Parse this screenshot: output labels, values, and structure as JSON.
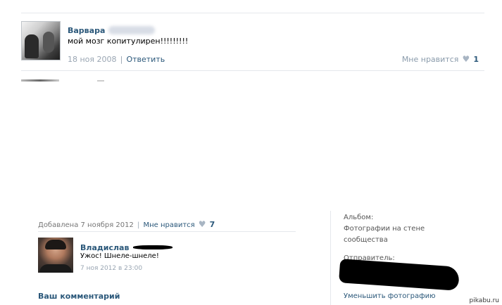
{
  "top_comment": {
    "author": "Варвара",
    "text": "мой мозг копитулирен!!!!!!!!!",
    "date": "18 ноя 2008",
    "separator": "|",
    "reply_label": "Ответить",
    "like_label": "Мне нравится",
    "like_count": "1"
  },
  "photo_meta": {
    "added_label": "Добавлена 7 ноября 2012",
    "separator": "|",
    "like_label": "Мне нравится",
    "like_count": "7"
  },
  "comment": {
    "author": "Владислав",
    "text": "Ужос! Шнеле-шнеле!",
    "date": "7 ноя 2012 в 23:00"
  },
  "your_comment_label": "Ваш комментарий",
  "sidebar": {
    "album_label": "Альбом:",
    "album_name_line1": "Фотографии на стене",
    "album_name_line2": "сообщества",
    "sender_label": "Отправитель:",
    "shrink_link": "Уменьшить фотографию"
  },
  "watermark": "pikabu.ru",
  "icons": {
    "heart": "heart-icon"
  },
  "colors": {
    "link": "#2b587a",
    "meta": "#9aa6b3",
    "divider": "#e5e8ec"
  }
}
